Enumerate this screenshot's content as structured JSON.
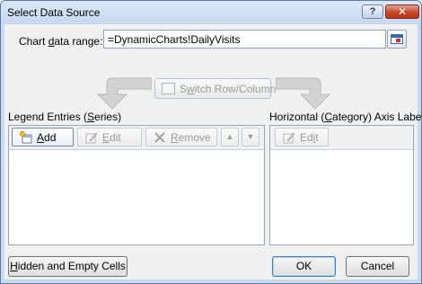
{
  "window": {
    "title": "Select Data Source",
    "help_label": "?",
    "close_label": "✕"
  },
  "range": {
    "label_pre": "Chart ",
    "label_u": "d",
    "label_post": "ata range:",
    "value": "=DynamicCharts!DailyVisits"
  },
  "switch": {
    "label_pre": "S",
    "label_u": "w",
    "label_post": "itch Row/Column"
  },
  "legend": {
    "label_pre": "Legend Entries (",
    "label_u": "S",
    "label_post": "eries)",
    "add_u": "A",
    "add_rest": "dd",
    "edit_u": "E",
    "edit_rest": "dit",
    "remove_u": "R",
    "remove_rest": "emove",
    "up_label": "▲",
    "down_label": "▼",
    "items": []
  },
  "axis": {
    "label_pre": "Horizontal (",
    "label_u": "C",
    "label_post": "ategory) Axis Labels",
    "edit_pre": "Ed",
    "edit_u": "i",
    "edit_post": "t",
    "items": []
  },
  "footer": {
    "hidden_u": "H",
    "hidden_rest": "idden and Empty Cells",
    "ok_label": "OK",
    "cancel_label": "Cancel"
  },
  "colors": {
    "frame": "#c9d9ee",
    "client": "#f0f0f0",
    "close": "#c8462c",
    "focus_border": "#3c7fb1"
  }
}
